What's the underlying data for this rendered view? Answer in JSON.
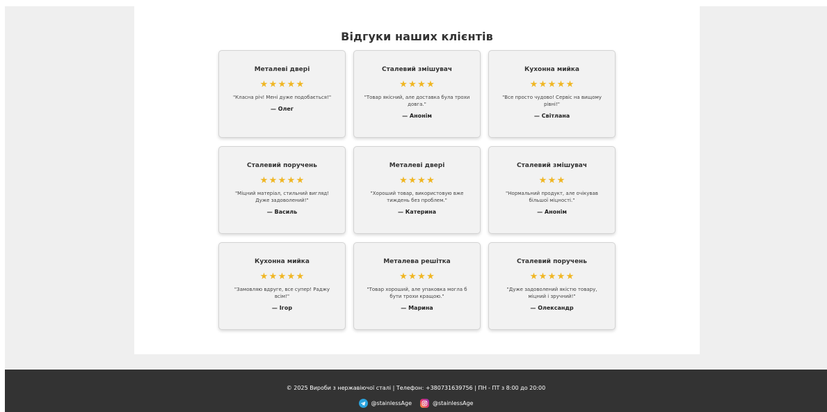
{
  "reviews_section": {
    "title": "Відгуки наших клієнтів",
    "star_color": "#f0b623",
    "reviews": [
      {
        "product": "Металеві двері",
        "rating": 5,
        "text": "\"Класна річ! Мені дуже подобається!\"",
        "author": "— Олег"
      },
      {
        "product": "Сталевий змішувач",
        "rating": 4,
        "text": "\"Товар якісний, але доставка була трохи довга.\"",
        "author": "— Анонім"
      },
      {
        "product": "Кухонна мийка",
        "rating": 5,
        "text": "\"Все просто чудово! Сервіс на вищому рівні!\"",
        "author": "— Світлана"
      },
      {
        "product": "Сталевий поручень",
        "rating": 5,
        "text": "\"Міцний матеріал, стильний вигляд! Дуже задоволений!\"",
        "author": "— Василь"
      },
      {
        "product": "Металеві двері",
        "rating": 4,
        "text": "\"Хороший товар, використовую вже тиждень без проблем.\"",
        "author": "— Катерина"
      },
      {
        "product": "Сталевий змішувач",
        "rating": 3,
        "text": "\"Нормальний продукт, але очікував більшої міцності.\"",
        "author": "— Анонім"
      },
      {
        "product": "Кухонна мийка",
        "rating": 5,
        "text": "\"Замовляю вдруге, все супер! Раджу всім!\"",
        "author": "— Ігор"
      },
      {
        "product": "Металева решітка",
        "rating": 4,
        "text": "\"Товар хороший, але упаковка могла б бути трохи кращою.\"",
        "author": "— Марина"
      },
      {
        "product": "Сталевий поручень",
        "rating": 5,
        "text": "\"Дуже задоволений якістю товару, міцний і зручний!\"",
        "author": "— Олександр"
      }
    ]
  },
  "footer": {
    "text": "© 2025 Вироби з нержавіючої сталі | Телефон: +380731639756 | ПН - ПТ з 8:00 до 20:00",
    "social": [
      {
        "icon": "telegram-icon",
        "label": "@stainlessAge"
      },
      {
        "icon": "instagram-icon",
        "label": "@stainlessAge"
      }
    ]
  }
}
